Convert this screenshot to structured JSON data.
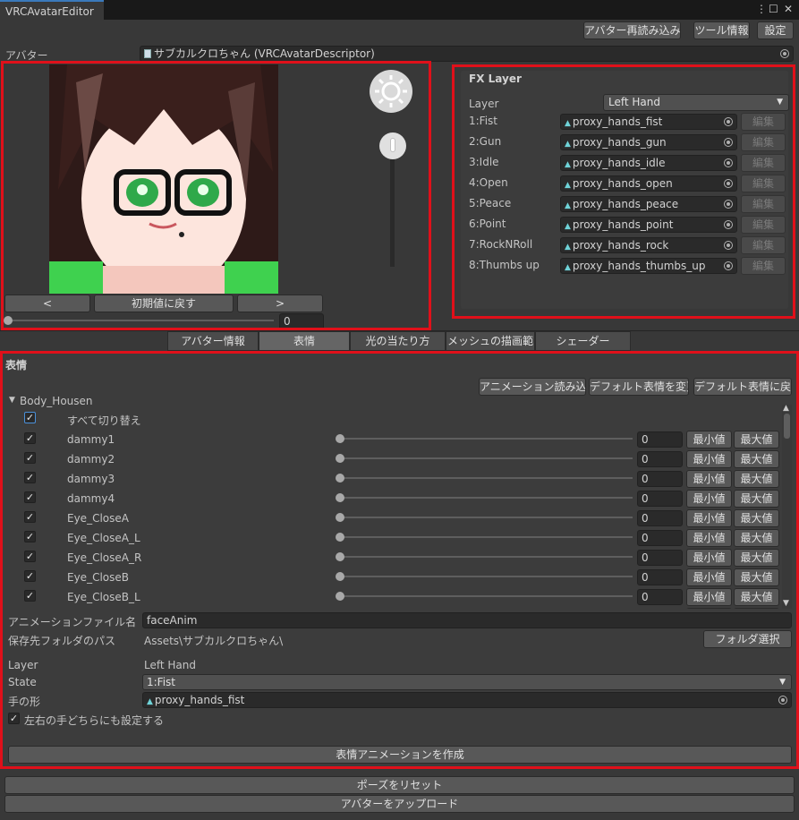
{
  "window": {
    "tab": "VRCAvatarEditor",
    "controls": [
      "⋮",
      "☐",
      "✕"
    ]
  },
  "toolbar": {
    "reload": "アバター再読み込み",
    "tool_info": "ツール情報",
    "settings": "設定"
  },
  "avatar": {
    "label": "アバター",
    "value": "サブカルクロちゃん (VRCAvatarDescriptor)"
  },
  "preview": {
    "prev": "<",
    "reset": "初期値に戻す",
    "next": ">",
    "slider_value": "0",
    "slider_fraction": 0
  },
  "fx": {
    "title": "FX Layer",
    "layer_label": "Layer",
    "layer_value": "Left Hand",
    "edit_label": "編集",
    "rows": [
      {
        "label": "1:Fist",
        "value": "proxy_hands_fist"
      },
      {
        "label": "2:Gun",
        "value": "proxy_hands_gun"
      },
      {
        "label": "3:Idle",
        "value": "proxy_hands_idle"
      },
      {
        "label": "4:Open",
        "value": "proxy_hands_open"
      },
      {
        "label": "5:Peace",
        "value": "proxy_hands_peace"
      },
      {
        "label": "6:Point",
        "value": "proxy_hands_point"
      },
      {
        "label": "7:RockNRoll",
        "value": "proxy_hands_rock"
      },
      {
        "label": "8:Thumbs up",
        "value": "proxy_hands_thumbs_up"
      }
    ]
  },
  "tabs": [
    "アバター情報",
    "表情",
    "光の当たり方",
    "メッシュの描画範囲",
    "シェーダー"
  ],
  "face": {
    "title": "表情",
    "load_anim": "アニメーション読み込み",
    "change_default": "デフォルト表情を変更",
    "revert_default": "デフォルト表情に戻す",
    "mesh": "Body_Housen",
    "toggle_all": "すべて切り替え",
    "min_label": "最小値",
    "max_label": "最大値",
    "blendshapes": [
      {
        "name": "dammy1",
        "value": "0"
      },
      {
        "name": "dammy2",
        "value": "0"
      },
      {
        "name": "dammy3",
        "value": "0"
      },
      {
        "name": "dammy4",
        "value": "0"
      },
      {
        "name": "Eye_CloseA",
        "value": "0"
      },
      {
        "name": "Eye_CloseA_L",
        "value": "0"
      },
      {
        "name": "Eye_CloseA_R",
        "value": "0"
      },
      {
        "name": "Eye_CloseB",
        "value": "0"
      },
      {
        "name": "Eye_CloseB_L",
        "value": "0"
      }
    ],
    "anim_file_label": "アニメーションファイル名",
    "anim_file_value": "faceAnim",
    "save_path_label": "保存先フォルダのパス",
    "save_path_value": "Assets\\サブカルクロちゃん\\",
    "folder_select": "フォルダ選択",
    "layer_label": "Layer",
    "layer_value": "Left Hand",
    "state_label": "State",
    "state_value": "1:Fist",
    "hand_label": "手の形",
    "hand_value": "proxy_hands_fist",
    "both_hands_label": "左右の手どちらにも設定する",
    "create": "表情アニメーションを作成"
  },
  "bottom": {
    "reset_pose": "ポーズをリセット",
    "upload": "アバターをアップロード"
  },
  "colors": {
    "highlight": "#e0101a",
    "accent": "#3a79bb"
  }
}
